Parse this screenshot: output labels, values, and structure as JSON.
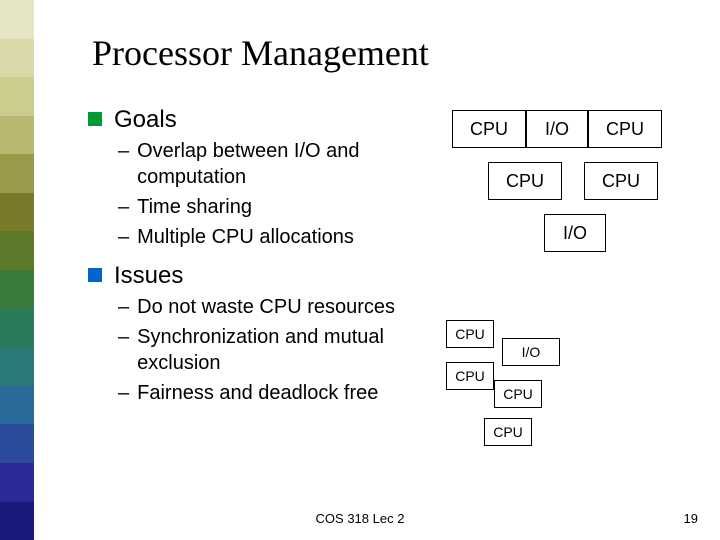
{
  "title": "Processor Management",
  "bullets": {
    "goals": {
      "label": "Goals",
      "color": "#009933",
      "subs": [
        "Overlap between I/O and computation",
        "Time sharing",
        "Multiple CPU allocations"
      ]
    },
    "issues": {
      "label": "Issues",
      "color": "#0066cc",
      "subs": [
        "Do not waste CPU resources",
        "Synchronization and mutual exclusion",
        "Fairness and deadlock free"
      ]
    }
  },
  "diagram1": {
    "row1": [
      "CPU",
      "I/O",
      "CPU"
    ],
    "row2": [
      "CPU",
      "CPU"
    ],
    "row3": [
      "I/O"
    ]
  },
  "diagram2": {
    "b1": "CPU",
    "b2": "I/O",
    "b3": "CPU",
    "b4": "CPU",
    "b5": "CPU"
  },
  "sidebar_colors": [
    "#e5e5c5",
    "#d8d8a8",
    "#cccc8f",
    "#b8b870",
    "#9a9a4a",
    "#7a7a2a",
    "#5c7a2a",
    "#3a7a3a",
    "#2a7a5c",
    "#2a7a7a",
    "#2a6a9a",
    "#2a4a9a",
    "#2a2a9a",
    "#1a1a7a"
  ],
  "footer": {
    "center": "COS 318 Lec 2",
    "page": "19"
  }
}
